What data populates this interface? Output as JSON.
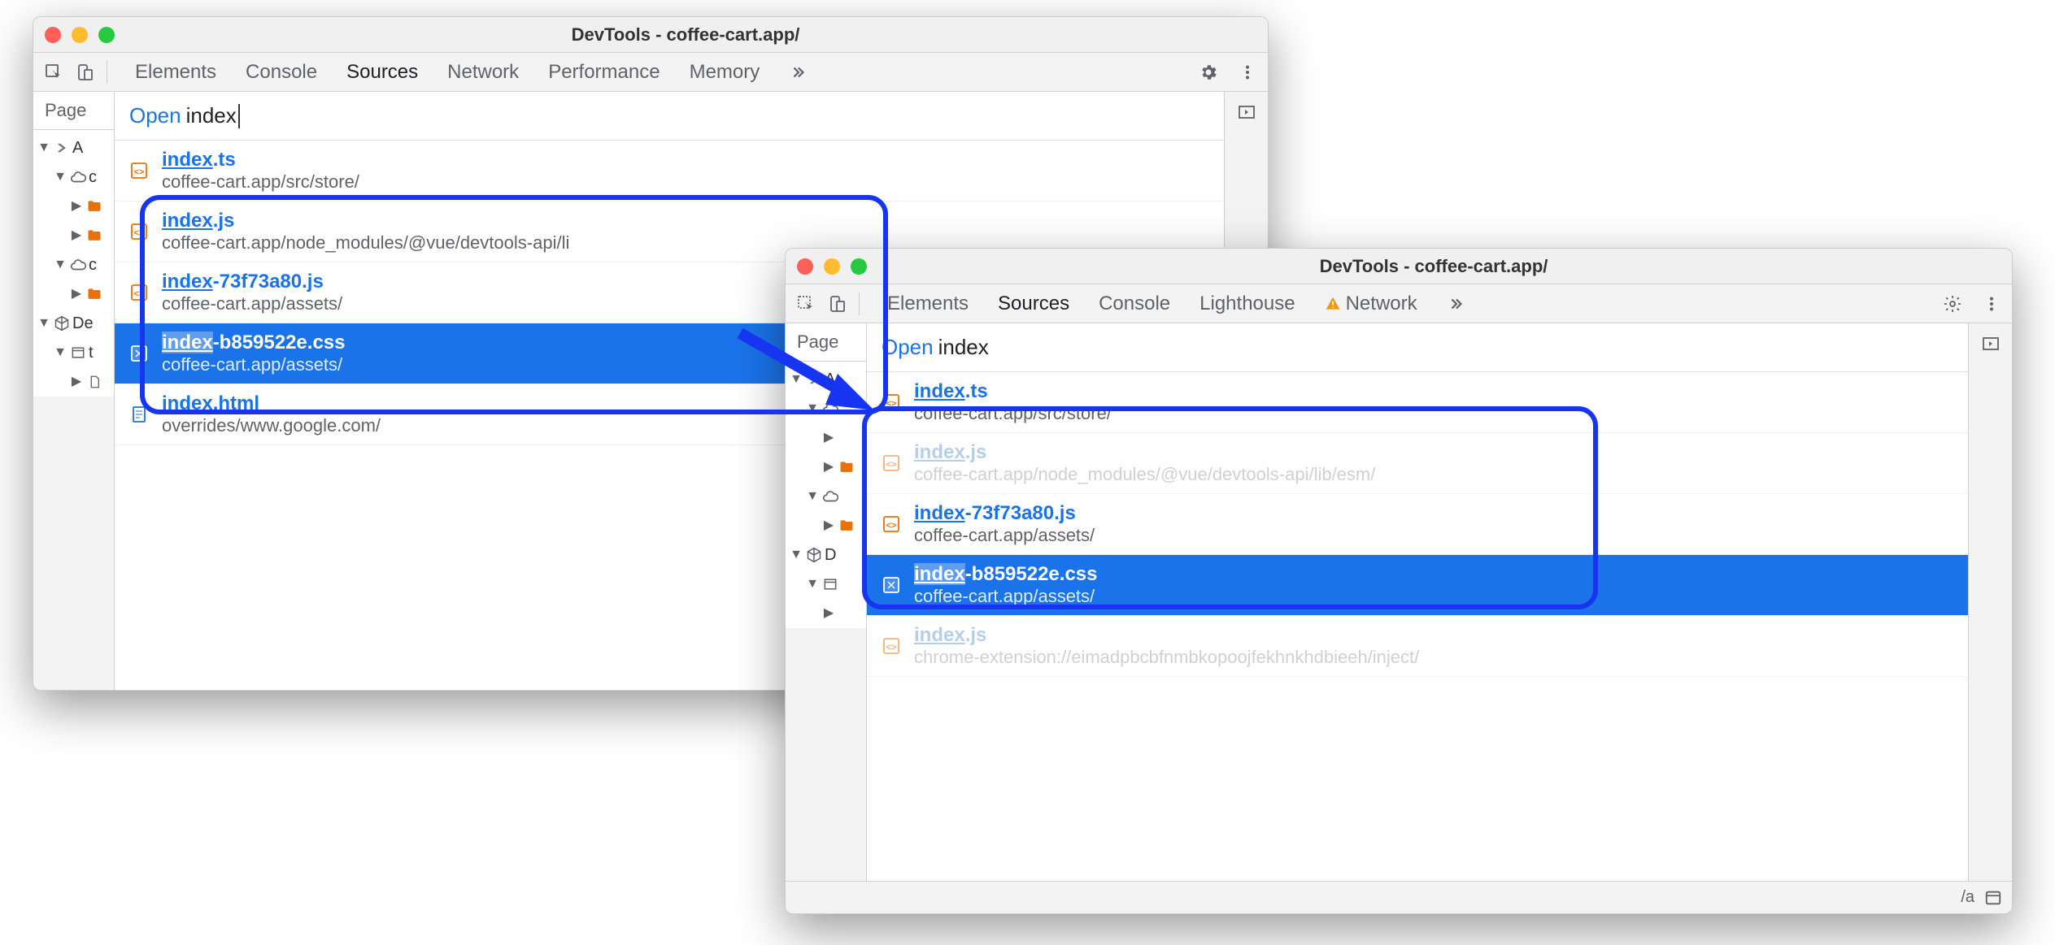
{
  "window1": {
    "title": "DevTools - coffee-cart.app/",
    "tabs": [
      "Elements",
      "Console",
      "Sources",
      "Network",
      "Performance",
      "Memory"
    ],
    "activeTab": "Sources",
    "sidebarTab": "Page",
    "tree": [
      {
        "label": "A",
        "depth": 0,
        "icon": "angle",
        "arrow": "down"
      },
      {
        "label": "c",
        "depth": 1,
        "icon": "cloud",
        "arrow": "down"
      },
      {
        "label": "",
        "depth": 2,
        "icon": "folder",
        "arrow": "right"
      },
      {
        "label": "",
        "depth": 2,
        "icon": "folder",
        "arrow": "right"
      },
      {
        "label": "c",
        "depth": 1,
        "icon": "cloud",
        "arrow": "down"
      },
      {
        "label": "",
        "depth": 2,
        "icon": "folder",
        "arrow": "right"
      },
      {
        "label": "De",
        "depth": 0,
        "icon": "cube",
        "arrow": "down"
      },
      {
        "label": "t",
        "depth": 1,
        "icon": "frame",
        "arrow": "down"
      },
      {
        "label": "",
        "depth": 2,
        "icon": "file",
        "arrow": "right"
      }
    ],
    "cmd": {
      "open": "Open",
      "query": "index"
    },
    "results": [
      {
        "icon": "js",
        "match": "index",
        "rest": ".ts",
        "path": "coffee-cart.app/src/store/",
        "sel": false,
        "dim": false
      },
      {
        "icon": "js",
        "match": "index",
        "rest": ".js",
        "path": "coffee-cart.app/node_modules/@vue/devtools-api/li",
        "sel": false,
        "dim": false
      },
      {
        "icon": "js",
        "match": "index",
        "rest": "-73f73a80.js",
        "path": "coffee-cart.app/assets/",
        "sel": false,
        "dim": false
      },
      {
        "icon": "css",
        "match": "index",
        "rest": "-b859522e.css",
        "path": "coffee-cart.app/assets/",
        "sel": true,
        "dim": false
      },
      {
        "icon": "doc",
        "match": "index",
        "rest": ".html",
        "path": "overrides/www.google.com/",
        "sel": false,
        "dim": false
      }
    ]
  },
  "window2": {
    "title": "DevTools - coffee-cart.app/",
    "tabs": [
      "Elements",
      "Sources",
      "Console",
      "Lighthouse",
      "Network"
    ],
    "activeTab": "Sources",
    "networkWarn": true,
    "sidebarTab": "Page",
    "tree": [
      {
        "label": "A",
        "depth": 0,
        "icon": "angle",
        "arrow": "down"
      },
      {
        "label": "",
        "depth": 1,
        "icon": "cloud",
        "arrow": "down"
      },
      {
        "label": "",
        "depth": 2,
        "icon": "",
        "arrow": "right"
      },
      {
        "label": "",
        "depth": 2,
        "icon": "folder",
        "arrow": "right"
      },
      {
        "label": "",
        "depth": 1,
        "icon": "cloud",
        "arrow": "down"
      },
      {
        "label": "",
        "depth": 2,
        "icon": "folder",
        "arrow": "right"
      },
      {
        "label": "D",
        "depth": 0,
        "icon": "cube",
        "arrow": "down"
      },
      {
        "label": "",
        "depth": 1,
        "icon": "frame",
        "arrow": "down"
      },
      {
        "label": "",
        "depth": 2,
        "icon": "",
        "arrow": "right"
      }
    ],
    "cmd": {
      "open": "Open",
      "query": "index"
    },
    "results": [
      {
        "icon": "js",
        "match": "index",
        "rest": ".ts",
        "path": "coffee-cart.app/src/store/",
        "sel": false,
        "dim": false
      },
      {
        "icon": "js",
        "match": "index",
        "rest": ".js",
        "path": "coffee-cart.app/node_modules/@vue/devtools-api/lib/esm/",
        "sel": false,
        "dim": true
      },
      {
        "icon": "js",
        "match": "index",
        "rest": "-73f73a80.js",
        "path": "coffee-cart.app/assets/",
        "sel": false,
        "dim": false
      },
      {
        "icon": "css",
        "match": "index",
        "rest": "-b859522e.css",
        "path": "coffee-cart.app/assets/",
        "sel": true,
        "dim": false
      },
      {
        "icon": "js",
        "match": "index",
        "rest": ".js",
        "path": "chrome-extension://eimadpbcbfnmbkopoojfekhnkhdbieeh/inject/",
        "sel": false,
        "dim": true
      }
    ],
    "footer": {
      "text": "/a"
    }
  }
}
